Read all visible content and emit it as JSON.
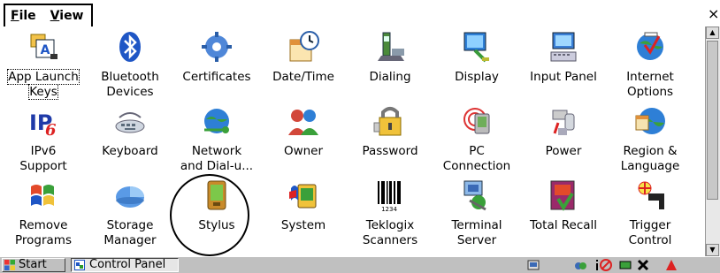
{
  "menu": {
    "file": {
      "label_u": "F",
      "label_rest": "ile"
    },
    "view": {
      "label_u": "V",
      "label_rest": "iew"
    }
  },
  "window": {
    "close_glyph": "×"
  },
  "icons": [
    {
      "label": "App Launch Keys",
      "line1": "App Launch",
      "line2": "Keys",
      "icon": "app-launch-keys-icon",
      "selected": true
    },
    {
      "label": "Bluetooth Devices",
      "line1": "Bluetooth",
      "line2": "Devices",
      "icon": "bluetooth-icon"
    },
    {
      "label": "Certificates",
      "line1": "Certificates",
      "line2": "",
      "icon": "certificates-icon"
    },
    {
      "label": "Date/Time",
      "line1": "Date/Time",
      "line2": "",
      "icon": "date-time-icon"
    },
    {
      "label": "Dialing",
      "line1": "Dialing",
      "line2": "",
      "icon": "dialing-icon"
    },
    {
      "label": "Display",
      "line1": "Display",
      "line2": "",
      "icon": "display-icon"
    },
    {
      "label": "Input Panel",
      "line1": "Input Panel",
      "line2": "",
      "icon": "input-panel-icon"
    },
    {
      "label": "Internet Options",
      "line1": "Internet",
      "line2": "Options",
      "icon": "internet-options-icon"
    },
    {
      "label": "IPv6 Support",
      "line1": "IPv6",
      "line2": "Support",
      "icon": "ipv6-icon"
    },
    {
      "label": "Keyboard",
      "line1": "Keyboard",
      "line2": "",
      "icon": "keyboard-icon"
    },
    {
      "label": "Network and Dial-u...",
      "line1": "Network",
      "line2": "and Dial-u...",
      "icon": "network-icon"
    },
    {
      "label": "Owner",
      "line1": "Owner",
      "line2": "",
      "icon": "owner-icon"
    },
    {
      "label": "Password",
      "line1": "Password",
      "line2": "",
      "icon": "password-icon"
    },
    {
      "label": "PC Connection",
      "line1": "PC",
      "line2": "Connection",
      "icon": "pc-connection-icon"
    },
    {
      "label": "Power",
      "line1": "Power",
      "line2": "",
      "icon": "power-icon"
    },
    {
      "label": "Region & Language",
      "line1": "Region &",
      "line2": "Language",
      "icon": "region-language-icon"
    },
    {
      "label": "Remove Programs",
      "line1": "Remove",
      "line2": "Programs",
      "icon": "remove-programs-icon"
    },
    {
      "label": "Storage Manager",
      "line1": "Storage",
      "line2": "Manager",
      "icon": "storage-manager-icon"
    },
    {
      "label": "Stylus",
      "line1": "Stylus",
      "line2": "",
      "icon": "stylus-icon"
    },
    {
      "label": "System",
      "line1": "System",
      "line2": "",
      "icon": "system-icon"
    },
    {
      "label": "Teklogix Scanners",
      "line1": "Teklogix",
      "line2": "Scanners",
      "icon": "teklogix-scanners-icon"
    },
    {
      "label": "Terminal Server",
      "line1": "Terminal",
      "line2": "Server",
      "icon": "terminal-server-icon"
    },
    {
      "label": "Total Recall",
      "line1": "Total Recall",
      "line2": "",
      "icon": "total-recall-icon"
    },
    {
      "label": "Trigger Control",
      "line1": "Trigger",
      "line2": "Control",
      "icon": "trigger-control-icon"
    }
  ],
  "taskbar": {
    "start_label": "Start",
    "task_label": "Control Panel",
    "tray_icons": [
      "network-tray-icon",
      "connection-tray-icon",
      "info-tray-icon",
      "no-signal-tray-icon",
      "battery-tray-icon",
      "x-tray-icon",
      "warning-tray-icon"
    ]
  },
  "colors": {
    "taskbar": "#c0c0c0",
    "windows_blue": "#1f56c5",
    "annotation": "#000000"
  }
}
